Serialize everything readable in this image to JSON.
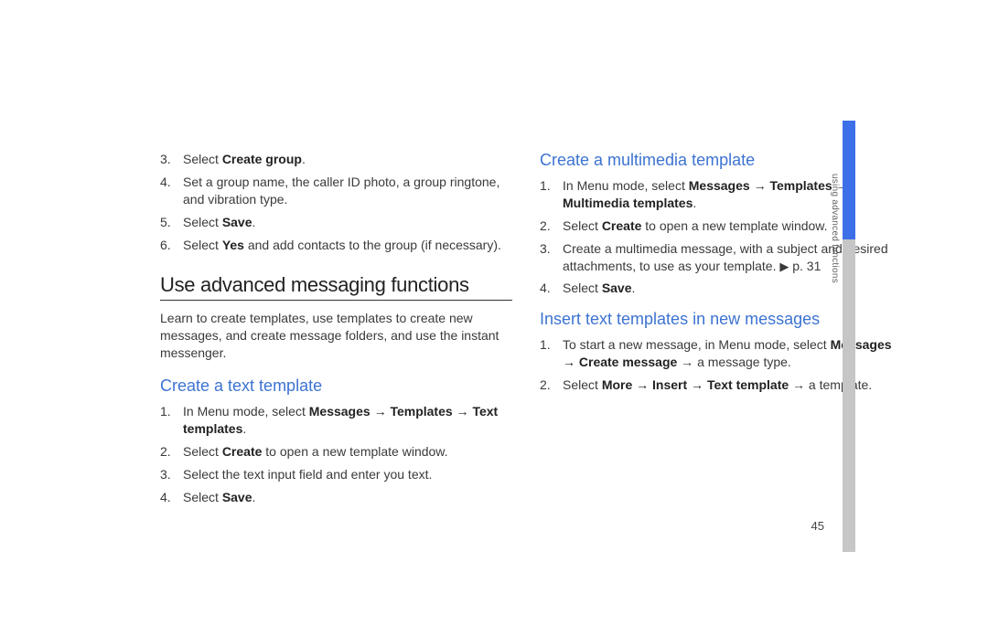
{
  "left": {
    "list1": {
      "item3": {
        "prefix": "Select ",
        "bold": "Create group",
        "suffix": "."
      },
      "item4": {
        "text": "Set a group name, the caller ID photo, a group ringtone, and vibration type."
      },
      "item5": {
        "prefix": "Select ",
        "bold": "Save",
        "suffix": "."
      },
      "item6": {
        "prefix": "Select ",
        "bold": "Yes",
        "suffix": " and add contacts to the group (if necessary)."
      }
    },
    "sectionTitle": "Use advanced messaging functions",
    "sectionDesc": "Learn to create templates, use templates to create new messages, and create message folders, and use the instant messenger.",
    "sub1": {
      "title": "Create a text template",
      "item1": {
        "prefix": "In Menu mode, select ",
        "bold": "Messages → Templates → Text templates",
        "suffix": "."
      },
      "item2": {
        "prefix": "Select ",
        "bold": "Create",
        "suffix": " to open a new template window."
      },
      "item3": {
        "text": "Select the text input field and enter you text."
      },
      "item4": {
        "prefix": "Select ",
        "bold": "Save",
        "suffix": "."
      }
    }
  },
  "right": {
    "sub2": {
      "title": "Create a multimedia template",
      "item1": {
        "prefix": "In Menu mode, select ",
        "bold": "Messages → Templates → Multimedia templates",
        "suffix": "."
      },
      "item2": {
        "prefix": "Select ",
        "bold": "Create",
        "suffix": " to open a new template window."
      },
      "item3": {
        "prefix": "Create a multimedia message, with a subject and desired attachments, to use as your template. ",
        "xref": "▶",
        "page": " p. 31"
      },
      "item4": {
        "prefix": "Select ",
        "bold": "Save",
        "suffix": "."
      }
    },
    "sub3": {
      "title": "Insert text templates in new messages",
      "item1": {
        "prefix": "To start a new message, in Menu mode, select ",
        "bold": "Messages → Create message",
        "suffix": " → a message type."
      },
      "item2": {
        "prefix": "Select ",
        "bold": "More → Insert → Text template",
        "suffix": " → a template."
      }
    }
  },
  "sideText": "using advanced functions",
  "pageNumber": "45"
}
